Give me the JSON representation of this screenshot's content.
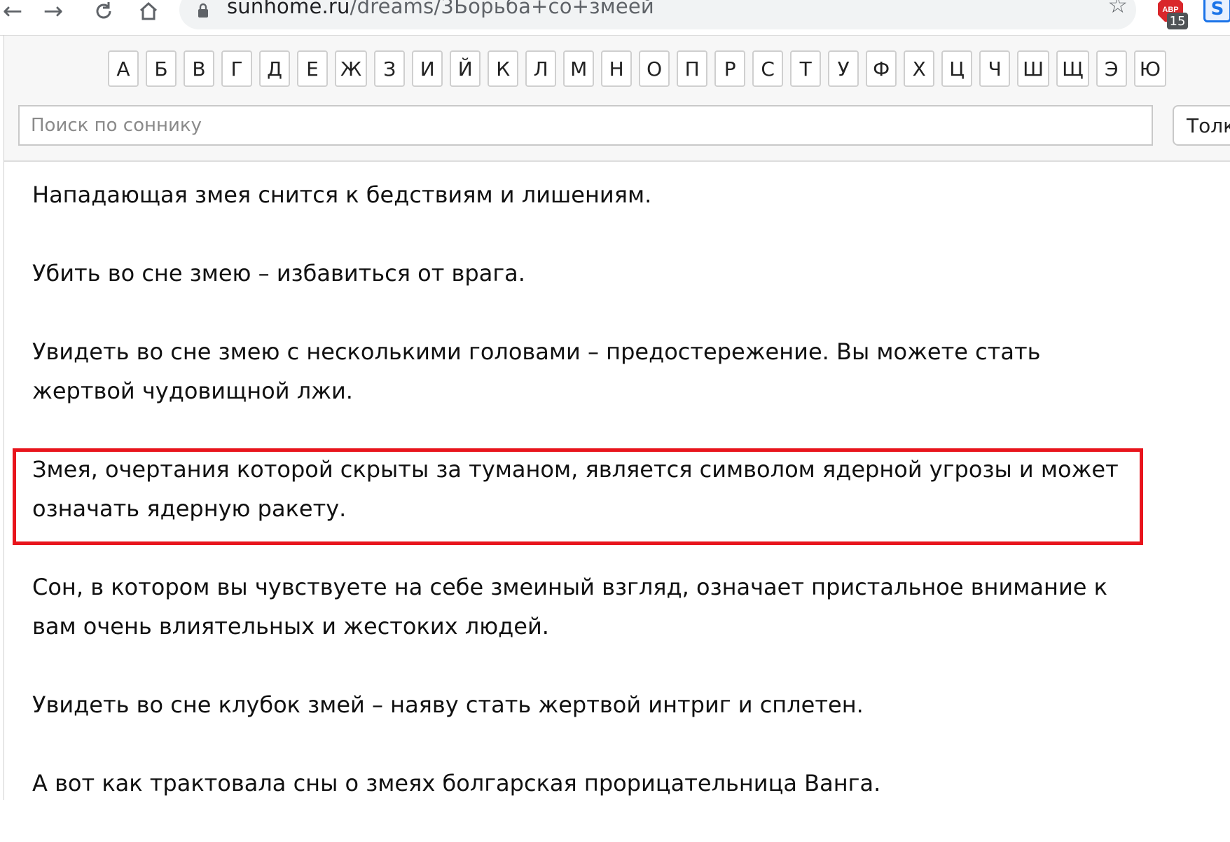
{
  "browser": {
    "url_host": "sunhome.ru",
    "url_path": "/dreams/3Борьба+со+змеей",
    "extension_abp_badge": "15",
    "extension_abp_label": "ABP",
    "extension_s_label": "S"
  },
  "alphabet": [
    "А",
    "Б",
    "В",
    "Г",
    "Д",
    "Е",
    "Ж",
    "З",
    "И",
    "Й",
    "К",
    "Л",
    "М",
    "Н",
    "О",
    "П",
    "Р",
    "С",
    "Т",
    "У",
    "Ф",
    "Х",
    "Ц",
    "Ч",
    "Ш",
    "Щ",
    "Э",
    "Ю"
  ],
  "search": {
    "placeholder": "Поиск по соннику",
    "button_label": "Толк"
  },
  "paragraphs": [
    "Нападающая змея снится к бедствиям и лишениям.",
    "Убить во сне змею – избавиться от врага.",
    "Увидеть во сне змею с несколькими головами – предостережение. Вы можете стать жертвой чудовищной лжи.",
    "Змея, очертания которой скрыты за туманом, является символом ядерной угрозы и может означать ядерную ракету.",
    "Сон, в котором вы чувствуете на себе змеиный взгляд, означает пристальное внимание к вам очень влиятельных и жестоких людей.",
    "Увидеть во сне клубок змей – наяву стать жертвой интриг и сплетен.",
    "А вот как трактовала сны о змеях болгарская прорицательница Ванга."
  ],
  "highlighted_paragraph_index": 3,
  "colors": {
    "highlight_border": "#e8141c",
    "extension_accent": "#1a73e8"
  }
}
